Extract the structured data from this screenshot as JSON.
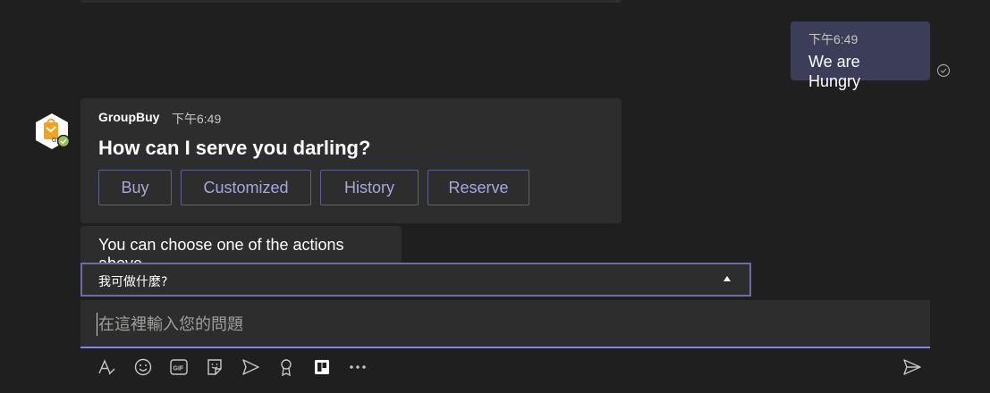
{
  "outgoing": {
    "time": "下午6:49",
    "text": "We are Hungry"
  },
  "bot_card": {
    "sender": "GroupBuy",
    "time": "下午6:49",
    "title": "How can I serve you darling?",
    "actions": [
      "Buy",
      "Customized",
      "History",
      "Reserve"
    ]
  },
  "info_message": "You can choose one of the actions above.",
  "suggestion": "我可做什麼?",
  "compose": {
    "placeholder": "在這裡輸入您的問題"
  },
  "icons": {
    "read_receipt": "check-circle-icon",
    "avatar": "groupbuy-bot-avatar",
    "presence": "available-status-icon",
    "toolbar": [
      "format-icon",
      "emoji-icon",
      "gif-icon",
      "sticker-icon",
      "meet-now-icon",
      "praise-icon",
      "board-app-icon",
      "more-options-icon",
      "send-icon"
    ]
  },
  "colors": {
    "background": "#1f1f1f",
    "card": "#2d2d2d",
    "outgoing_bubble": "#3c3d58",
    "accent": "#7f85f5",
    "button_text": "#a6a7dc",
    "presence_green": "#92c353"
  }
}
